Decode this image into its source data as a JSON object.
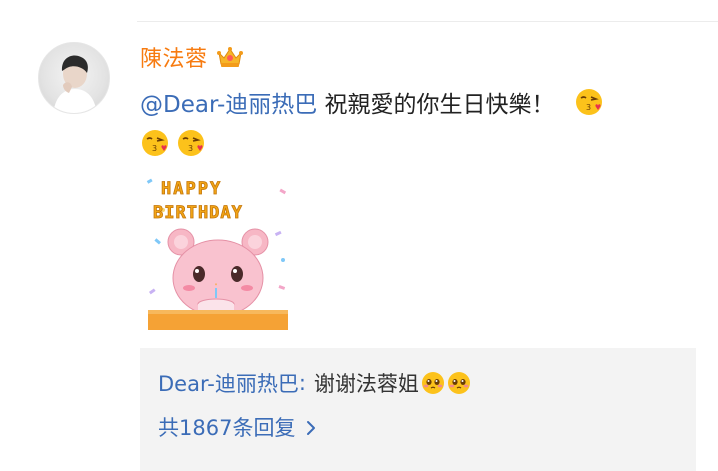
{
  "post": {
    "author": "陳法蓉",
    "vip_icon": "crown-vip-icon",
    "mention": "@Dear-迪丽热巴",
    "text": " 祝親愛的你生日快樂！",
    "emoji": "kiss-face-icon",
    "sticker": {
      "line1": "HAPPY",
      "line2": "BIRTHDAY"
    }
  },
  "reply": {
    "author": "Dear-迪丽热巴",
    "separator": ":",
    "text": "谢谢法蓉姐",
    "emoji": "pleading-face-icon",
    "more_label": "共1867条回复"
  },
  "colors": {
    "username": "#f77b10",
    "link": "#3b6cb7",
    "reply_bg": "#f3f3f3"
  }
}
